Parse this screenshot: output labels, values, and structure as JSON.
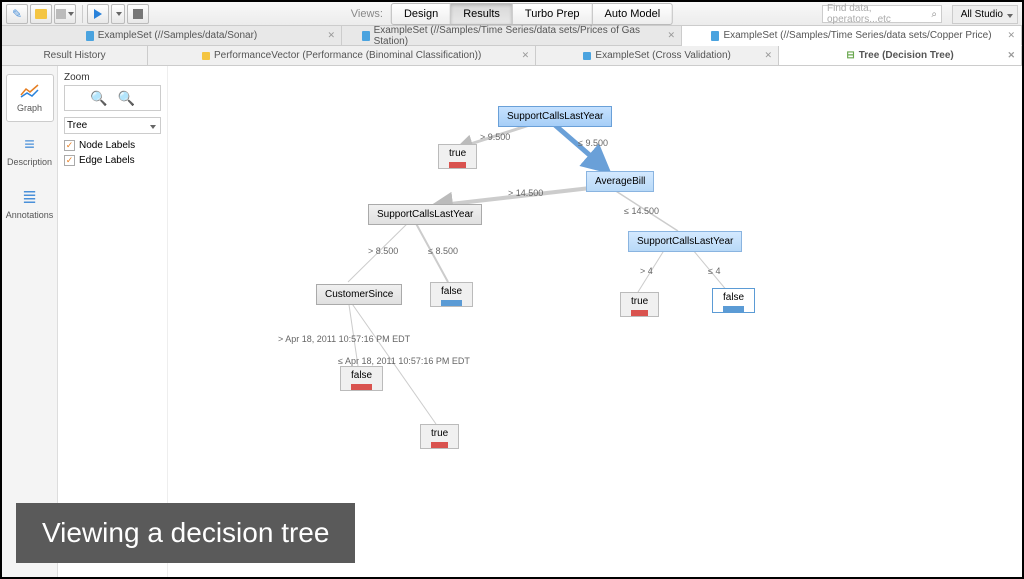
{
  "toolbar": {
    "views_label": "Views:",
    "tabs": [
      "Design",
      "Results",
      "Turbo Prep",
      "Auto Model"
    ],
    "active_view": "Results",
    "search_placeholder": "Find data, operators...etc",
    "studio_label": "All Studio ▾"
  },
  "file_tabs": [
    {
      "label": "ExampleSet (//Samples/data/Sonar)"
    },
    {
      "label": "ExampleSet (//Samples/Time Series/data sets/Prices of Gas Station)"
    },
    {
      "label": "ExampleSet (//Samples/Time Series/data sets/Copper Price)"
    }
  ],
  "sub_tabs": [
    {
      "label": "Result History",
      "icon": "none"
    },
    {
      "label": "PerformanceVector (Performance (Binominal Classification))",
      "icon": "yellow"
    },
    {
      "label": "ExampleSet (Cross Validation)",
      "icon": "blue"
    },
    {
      "label": "Tree (Decision Tree)",
      "icon": "tree",
      "active": true
    }
  ],
  "left_panel": {
    "items": [
      {
        "label": "Graph",
        "active": true
      },
      {
        "label": "Description"
      },
      {
        "label": "Annotations"
      }
    ]
  },
  "controls": {
    "zoom_label": "Zoom",
    "select_value": "Tree",
    "check_node": "Node Labels",
    "check_edge": "Edge Labels"
  },
  "tree": {
    "nodes": {
      "n1": {
        "text": "SupportCallsLastYear"
      },
      "n2": {
        "text": "AverageBill"
      },
      "n3": {
        "text": "SupportCallsLastYear"
      },
      "n4": {
        "text": "SupportCallsLastYear"
      },
      "n5": {
        "text": "CustomerSince"
      }
    },
    "leaves": {
      "l1": {
        "text": "true",
        "bar": "red"
      },
      "l2": {
        "text": "false",
        "bar": "blue"
      },
      "l3": {
        "text": "true",
        "bar": "red"
      },
      "l4": {
        "text": "false",
        "bar": "blue"
      },
      "l5": {
        "text": "false",
        "bar": "red"
      },
      "l6": {
        "text": "true",
        "bar": "red"
      }
    },
    "edges": {
      "e1": "> 9.500",
      "e2": "≤ 9.500",
      "e3": "> 14.500",
      "e4": "≤ 14.500",
      "e5": "> 8.500",
      "e6": "≤ 8.500",
      "e7": "> 4",
      "e8": "≤ 4",
      "e9": "> Apr 18, 2011 10:57:16 PM EDT",
      "e10": "≤ Apr 18, 2011 10:57:16 PM EDT"
    }
  },
  "caption": "Viewing a decision tree"
}
